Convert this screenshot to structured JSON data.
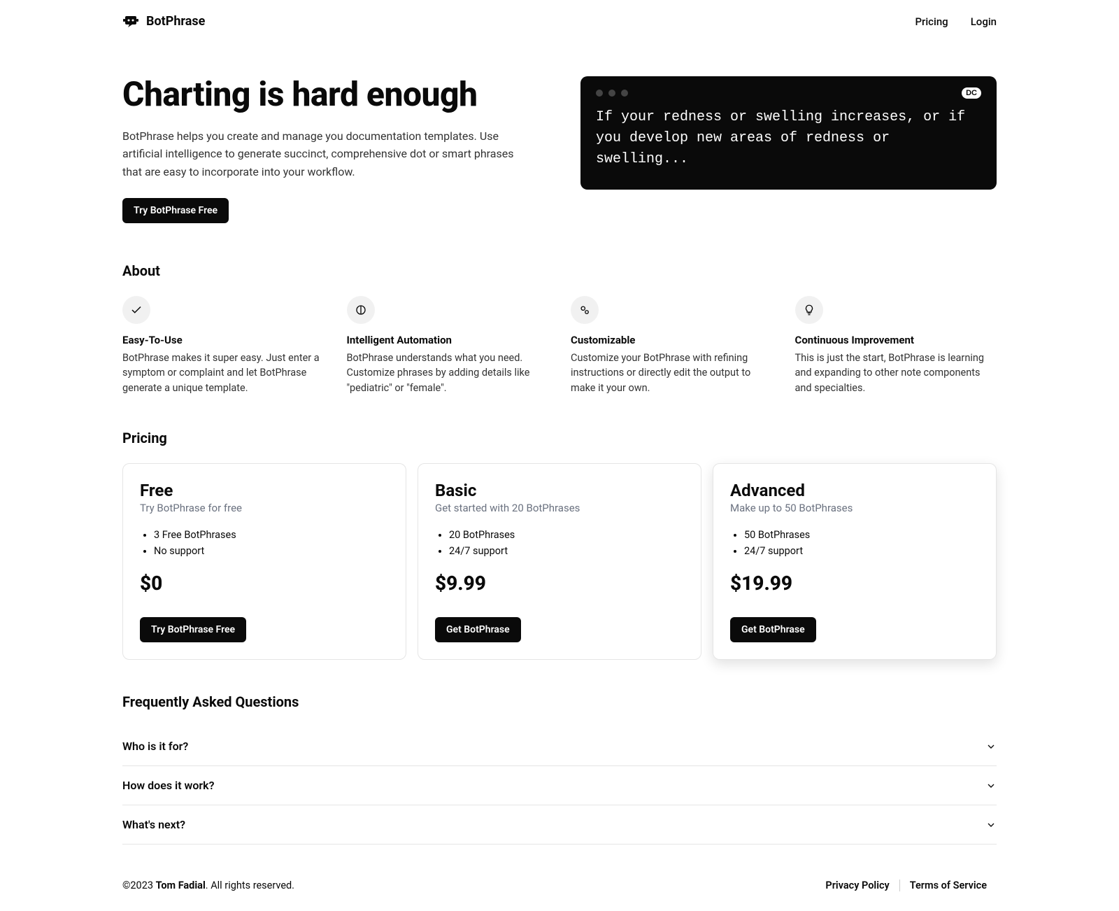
{
  "brand": "BotPhrase",
  "nav": {
    "pricing": "Pricing",
    "login": "Login"
  },
  "hero": {
    "title": "Charting is hard enough",
    "subtitle": "BotPhrase helps you create and manage you documentation templates. Use artificial intelligence to generate succinct, comprehensive dot or smart phrases that are easy to incorporate into your workflow.",
    "cta": "Try BotPhrase Free",
    "terminal": {
      "badge": "DC",
      "text": "If your redness or swelling increases, or if you develop new areas of redness or swelling..."
    }
  },
  "about": {
    "heading": "About",
    "features": [
      {
        "title": "Easy-To-Use",
        "desc": "BotPhrase makes it super easy. Just enter a symptom or complaint and let BotPhrase generate a unique template."
      },
      {
        "title": "Intelligent Automation",
        "desc": "BotPhrase understands what you need. Customize phrases by adding details like \"pediatric\" or \"female\"."
      },
      {
        "title": "Customizable",
        "desc": "Customize your BotPhrase with refining instructions or directly edit the output to make it your own."
      },
      {
        "title": "Continuous Improvement",
        "desc": "This is just the start, BotPhrase is learning and expanding to other note components and specialties."
      }
    ]
  },
  "pricing": {
    "heading": "Pricing",
    "plans": [
      {
        "name": "Free",
        "subtitle": "Try BotPhrase for free",
        "features": [
          "3 Free BotPhrases",
          "No support"
        ],
        "price": "$0",
        "cta": "Try BotPhrase Free"
      },
      {
        "name": "Basic",
        "subtitle": "Get started with 20 BotPhrases",
        "features": [
          "20 BotPhrases",
          "24/7 support"
        ],
        "price": "$9.99",
        "cta": "Get BotPhrase"
      },
      {
        "name": "Advanced",
        "subtitle": "Make up to 50 BotPhrases",
        "features": [
          "50 BotPhrases",
          "24/7 support"
        ],
        "price": "$19.99",
        "cta": "Get BotPhrase"
      }
    ]
  },
  "faq": {
    "heading": "Frequently Asked Questions",
    "items": [
      "Who is it for?",
      "How does it work?",
      "What's next?"
    ]
  },
  "footer": {
    "copyright_prefix": "©2023 ",
    "owner": "Tom Fadial",
    "copyright_suffix": ". All rights reserved.",
    "privacy": "Privacy Policy",
    "terms": "Terms of Service"
  }
}
